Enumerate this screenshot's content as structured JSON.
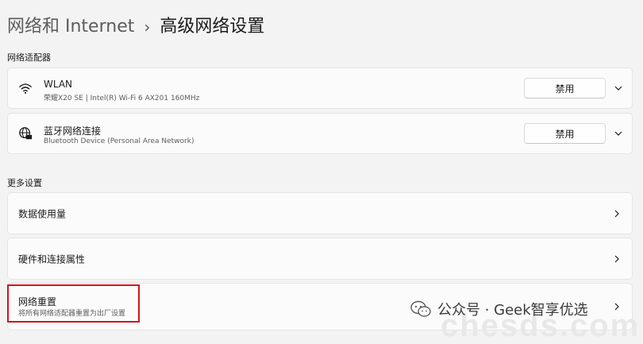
{
  "breadcrumb": {
    "parent": "网络和 Internet",
    "separator": "›",
    "current": "高级网络设置"
  },
  "sections": {
    "adapters_label": "网络适配器",
    "more_label": "更多设置"
  },
  "adapters": [
    {
      "icon": "wifi-icon",
      "title": "WLAN",
      "subtitle": "荣耀X20 SE | Intel(R) Wi-Fi 6 AX201 160MHz",
      "button_label": "禁用"
    },
    {
      "icon": "globe-icon",
      "title": "蓝牙网络连接",
      "subtitle": "Bluetooth Device (Personal Area Network)",
      "button_label": "禁用"
    }
  ],
  "more_settings": [
    {
      "title": "数据使用量"
    },
    {
      "title": "硬件和连接属性"
    },
    {
      "title": "网络重置",
      "subtitle": "将所有网络适配器重置为出厂设置"
    }
  ],
  "watermark": {
    "text": "公众号 · Geek智享优选",
    "bg_text": "chesds.com"
  },
  "colors": {
    "background": "#f3f3f3",
    "card": "#fbfbfb",
    "highlight": "#d0161b"
  }
}
